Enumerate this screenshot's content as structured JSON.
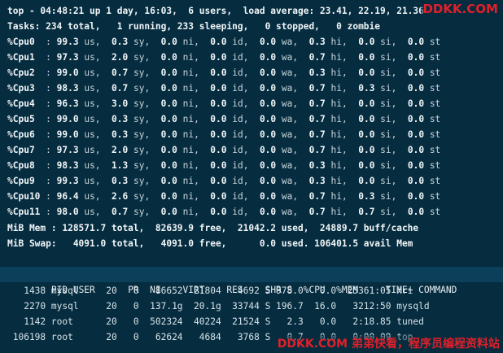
{
  "summary": {
    "top_line": "top - 04:48:21 up 1 day, 16:03,  6 users,  load average: 23.41, 22.19, 21.36",
    "tasks_line": "Tasks: 234 total,   1 running, 233 sleeping,   0 stopped,   0 zombie"
  },
  "cpus": [
    {
      "label": "%Cpu0 ",
      "us": "99.3",
      "sy": "0.3",
      "ni": "0.0",
      "id": "0.0",
      "wa": "0.0",
      "hi": "0.3",
      "si": "0.0",
      "st": "0.0"
    },
    {
      "label": "%Cpu1 ",
      "us": "97.3",
      "sy": "2.0",
      "ni": "0.0",
      "id": "0.0",
      "wa": "0.0",
      "hi": "0.7",
      "si": "0.0",
      "st": "0.0"
    },
    {
      "label": "%Cpu2 ",
      "us": "99.0",
      "sy": "0.7",
      "ni": "0.0",
      "id": "0.0",
      "wa": "0.0",
      "hi": "0.3",
      "si": "0.0",
      "st": "0.0"
    },
    {
      "label": "%Cpu3 ",
      "us": "98.3",
      "sy": "0.7",
      "ni": "0.0",
      "id": "0.0",
      "wa": "0.0",
      "hi": "0.7",
      "si": "0.3",
      "st": "0.0"
    },
    {
      "label": "%Cpu4 ",
      "us": "96.3",
      "sy": "3.0",
      "ni": "0.0",
      "id": "0.0",
      "wa": "0.0",
      "hi": "0.7",
      "si": "0.0",
      "st": "0.0"
    },
    {
      "label": "%Cpu5 ",
      "us": "99.0",
      "sy": "0.3",
      "ni": "0.0",
      "id": "0.0",
      "wa": "0.0",
      "hi": "0.7",
      "si": "0.0",
      "st": "0.0"
    },
    {
      "label": "%Cpu6 ",
      "us": "99.0",
      "sy": "0.3",
      "ni": "0.0",
      "id": "0.0",
      "wa": "0.0",
      "hi": "0.7",
      "si": "0.0",
      "st": "0.0"
    },
    {
      "label": "%Cpu7 ",
      "us": "97.3",
      "sy": "2.0",
      "ni": "0.0",
      "id": "0.0",
      "wa": "0.0",
      "hi": "0.7",
      "si": "0.0",
      "st": "0.0"
    },
    {
      "label": "%Cpu8 ",
      "us": "98.3",
      "sy": "1.3",
      "ni": "0.0",
      "id": "0.0",
      "wa": "0.0",
      "hi": "0.3",
      "si": "0.0",
      "st": "0.0"
    },
    {
      "label": "%Cpu9 ",
      "us": "99.3",
      "sy": "0.3",
      "ni": "0.0",
      "id": "0.0",
      "wa": "0.0",
      "hi": "0.3",
      "si": "0.0",
      "st": "0.0"
    },
    {
      "label": "%Cpu10",
      "us": "96.4",
      "sy": "2.6",
      "ni": "0.0",
      "id": "0.0",
      "wa": "0.0",
      "hi": "0.7",
      "si": "0.3",
      "st": "0.0"
    },
    {
      "label": "%Cpu11",
      "us": "98.0",
      "sy": "0.7",
      "ni": "0.0",
      "id": "0.0",
      "wa": "0.0",
      "hi": "0.7",
      "si": "0.7",
      "st": "0.0"
    }
  ],
  "memory": {
    "mem_line": "MiB Mem : 128571.7 total,  82639.9 free,  21042.2 used,  24889.7 buff/cache",
    "swap_line": "MiB Swap:   4091.0 total,   4091.0 free,      0.0 used. 106401.5 avail Mem"
  },
  "process_table": {
    "header": "    PID USER      PR  NI    VIRT    RES    SHR S  %CPU  %MEM     TIME+ COMMAND",
    "rows": [
      "   1438 mysql     20   0   86652  21804   4692 S 978.0   0.0  25361:05 xri",
      "   2270 mysql     20   0  137.1g  20.1g  33744 S 196.7  16.0   3212:50 mysqld",
      "   1142 root      20   0  502324  40224  21524 S   2.3   0.0   2:18.85 tuned",
      " 106198 root      20   0   62624   4684   3768 S   0.7   0.0   0:00.09 top"
    ]
  },
  "watermark": {
    "top": "DDKK.COM",
    "bottom": "DDKK.COM 弟弟快看，程序员编程资料站"
  },
  "colors": {
    "background": "#062c3f",
    "header_bar": "#0c3f59",
    "watermark": "#e0202a"
  }
}
